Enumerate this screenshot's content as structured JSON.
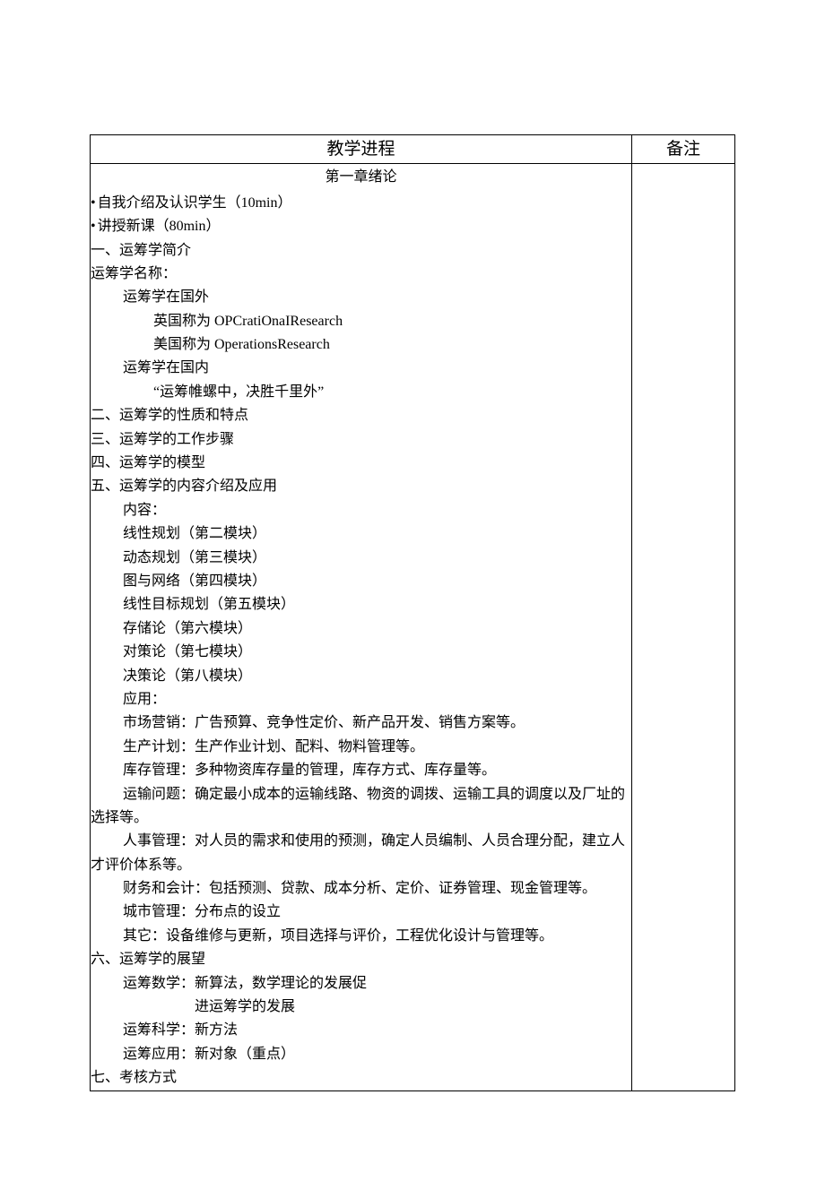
{
  "header": {
    "process": "教学进程",
    "note": "备注"
  },
  "chapter_title": "第一章绪论",
  "lines": {
    "l01": "自我介绍及认识学生（10min）",
    "l02": "讲授新课（80min）",
    "l03": "一、运筹学简介",
    "l04": "运筹学名称：",
    "l05": "运筹学在国外",
    "l06": "英国称为 OPCratiOnaIResearch",
    "l07": "美国称为 OperationsResearch",
    "l08": "运筹学在国内",
    "l09": "“运筹帷螺中，决胜千里外”",
    "l10": "二、运筹学的性质和特点",
    "l11": "三、运筹学的工作步骤",
    "l12": "四、运筹学的模型",
    "l13": "五、运筹学的内容介绍及应用",
    "l14": "内容：",
    "l15": "线性规划（第二模块）",
    "l16": "动态规划（第三模块）",
    "l17": "图与网络（第四模块）",
    "l18": "线性目标规划（第五模块）",
    "l19": "存储论（第六模块）",
    "l20": "对策论（第七模块）",
    "l21": "决策论（第八模块）",
    "l22": "应用：",
    "l23": "市场营销：广告预算、竞争性定价、新产品开发、销售方案等。",
    "l24": "生产计划：生产作业计划、配料、物料管理等。",
    "l25": "库存管理：多种物资库存量的管理，库存方式、库存量等。",
    "l26": "运输问题：确定最小成本的运输线路、物资的调拨、运输工具的调度以及厂址的",
    "l27": "选择等。",
    "l28": "人事管理：对人员的需求和使用的预测，确定人员编制、人员合理分配，建立人",
    "l29": "才评价体系等。",
    "l30": "财务和会计：包括预测、贷款、成本分析、定价、证券管理、现金管理等。",
    "l31": "城市管理：分布点的设立",
    "l32": "其它：设备维修与更新，项目选择与评价，工程优化设计与管理等。",
    "l33": "六、运筹学的展望",
    "l34": "运筹数学：新算法，数学理论的发展促",
    "l35": "进运筹学的发展",
    "l36": "运筹科学：新方法",
    "l37": "运筹应用：新对象（重点）",
    "l38": "七、考核方式"
  }
}
